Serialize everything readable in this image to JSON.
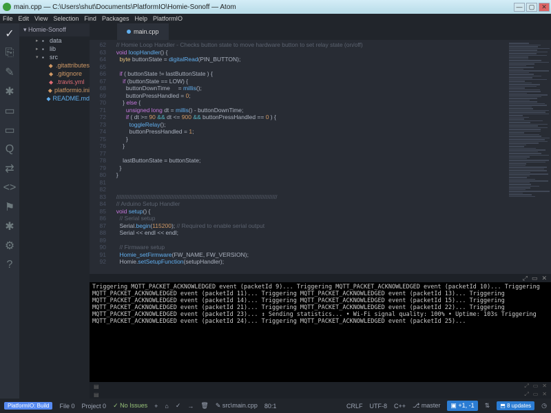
{
  "window": {
    "title": "main.cpp — C:\\Users\\shut\\Documents\\PlatformIO\\Homie-Sonoff — Atom"
  },
  "menu": [
    "File",
    "Edit",
    "View",
    "Selection",
    "Find",
    "Packages",
    "Help",
    "PlatformIO"
  ],
  "project": {
    "name": "Homie-Sonoff"
  },
  "tree": [
    {
      "label": "data",
      "cls": "folder",
      "lvl": 2,
      "caret": "▸",
      "icon": "▪"
    },
    {
      "label": "lib",
      "cls": "folder",
      "lvl": 2,
      "caret": "▸",
      "icon": "▪"
    },
    {
      "label": "src",
      "cls": "folder",
      "lvl": 2,
      "caret": "▾",
      "icon": "▪"
    },
    {
      "label": ".gitattributes",
      "cls": "fgit",
      "lvl": 3,
      "caret": "",
      "icon": "◆"
    },
    {
      "label": ".gitignore",
      "cls": "fgit",
      "lvl": 3,
      "caret": "",
      "icon": "◆"
    },
    {
      "label": ".travis.yml",
      "cls": "fyml",
      "lvl": 3,
      "caret": "",
      "icon": "◆"
    },
    {
      "label": "platformio.ini",
      "cls": "fini",
      "lvl": 3,
      "caret": "",
      "icon": "◆"
    },
    {
      "label": "README.md",
      "cls": "fmd",
      "lvl": 3,
      "caret": "",
      "icon": "◆"
    }
  ],
  "tab": {
    "name": "main.cpp"
  },
  "gstart": 62,
  "code": [
    "  <span class='cm'>// Homie Loop Handler - Checks button state to move hardware button to set relay state (on/off)</span>",
    "  <span class='kw'>void</span> <span class='fn'>loopHandler</span>() {",
    "    <span class='ty'>byte</span> buttonState = <span class='fn'>digitalRead</span>(PIN_BUTTON);",
    "",
    "    <span class='kw'>if</span> ( buttonState != lastButtonState ) {",
    "      <span class='kw'>if</span> (buttonState == LOW) {",
    "        buttonDownTime     = <span class='fn'>millis</span>();",
    "        buttonPressHandled = <span class='num'>0</span>;",
    "      } <span class='kw'>else</span> {",
    "        <span class='kw'>unsigned long</span> dt = <span class='fn'>millis</span>() - buttonDownTime;",
    "        <span class='kw'>if</span> ( dt >= <span class='num'>90</span> <span class='op'>&&</span> dt <= <span class='num'>900</span> <span class='op'>&&</span> buttonPressHandled == <span class='num'>0</span> ) {",
    "          <span class='fn'>toggleRelay</span>();",
    "          buttonPressHandled = <span class='num'>1</span>;",
    "        }",
    "      }",
    "",
    "      lastButtonState = buttonState;",
    "    }",
    "  }",
    "",
    "",
    "  <span class='cm'>///////////////////////////////////////////////////////////////////////////////////////////////////</span>",
    "  <span class='cm'>// Arduino Setup Handler</span>",
    "  <span class='kw'>void</span> <span class='fn'>setup</span>() {",
    "    <span class='cm'>// Serial setup</span>",
    "    Serial.<span class='fn'>begin</span>(<span class='num'>115200</span>); <span class='cm'>// Required to enable serial output</span>",
    "    Serial << endl << endl;",
    "",
    "    <span class='cm'>// Firmware setup</span>",
    "    <span class='fn'>Homie_setFirmware</span>(FW_NAME, FW_VERSION);",
    "    Homie.<span class='fn'>setSetupFunction</span>(setupHandler);"
  ],
  "term": [
    "Triggering MQTT_PACKET_ACKNOWLEDGED event (packetId 9)...",
    "Triggering MQTT_PACKET_ACKNOWLEDGED event (packetId 10)...",
    "Triggering MQTT_PACKET_ACKNOWLEDGED event (packetId 11)...",
    "Triggering MQTT_PACKET_ACKNOWLEDGED event (packetId 13)...",
    "Triggering MQTT_PACKET_ACKNOWLEDGED event (packetId 14)...",
    "Triggering MQTT_PACKET_ACKNOWLEDGED event (packetId 15)...",
    "Triggering MQTT_PACKET_ACKNOWLEDGED event (packetId 21)...",
    "Triggering MQTT_PACKET_ACKNOWLEDGED event (packetId 22)...",
    "Triggering MQTT_PACKET_ACKNOWLEDGED event (packetId 23)...",
    "↕ Sending statistics...",
    "  • Wi-Fi signal quality: 100%",
    "  • Uptime: 103s",
    "Triggering MQTT_PACKET_ACKNOWLEDGED event (packetId 24)...",
    "Triggering MQTT_PACKET_ACKNOWLEDGED event (packetId 25)..."
  ],
  "status": {
    "build": "PlatformIO: Build",
    "file": "File",
    "fileN": "0",
    "project": "Project",
    "projectN": "0",
    "noissues": "No Issues",
    "path": "src\\main.cpp",
    "pos": "80:1",
    "crlf": "CRLF",
    "enc": "UTF-8",
    "lang": "C++",
    "branch": "master",
    "diff": "+1, -1",
    "updates": "8 updates"
  },
  "activity": [
    "✓",
    "⎘",
    "✎",
    "✱",
    "▭",
    "▭",
    "Q",
    "⇄",
    "<>",
    "⚑",
    "✱",
    "⚙",
    "?"
  ]
}
